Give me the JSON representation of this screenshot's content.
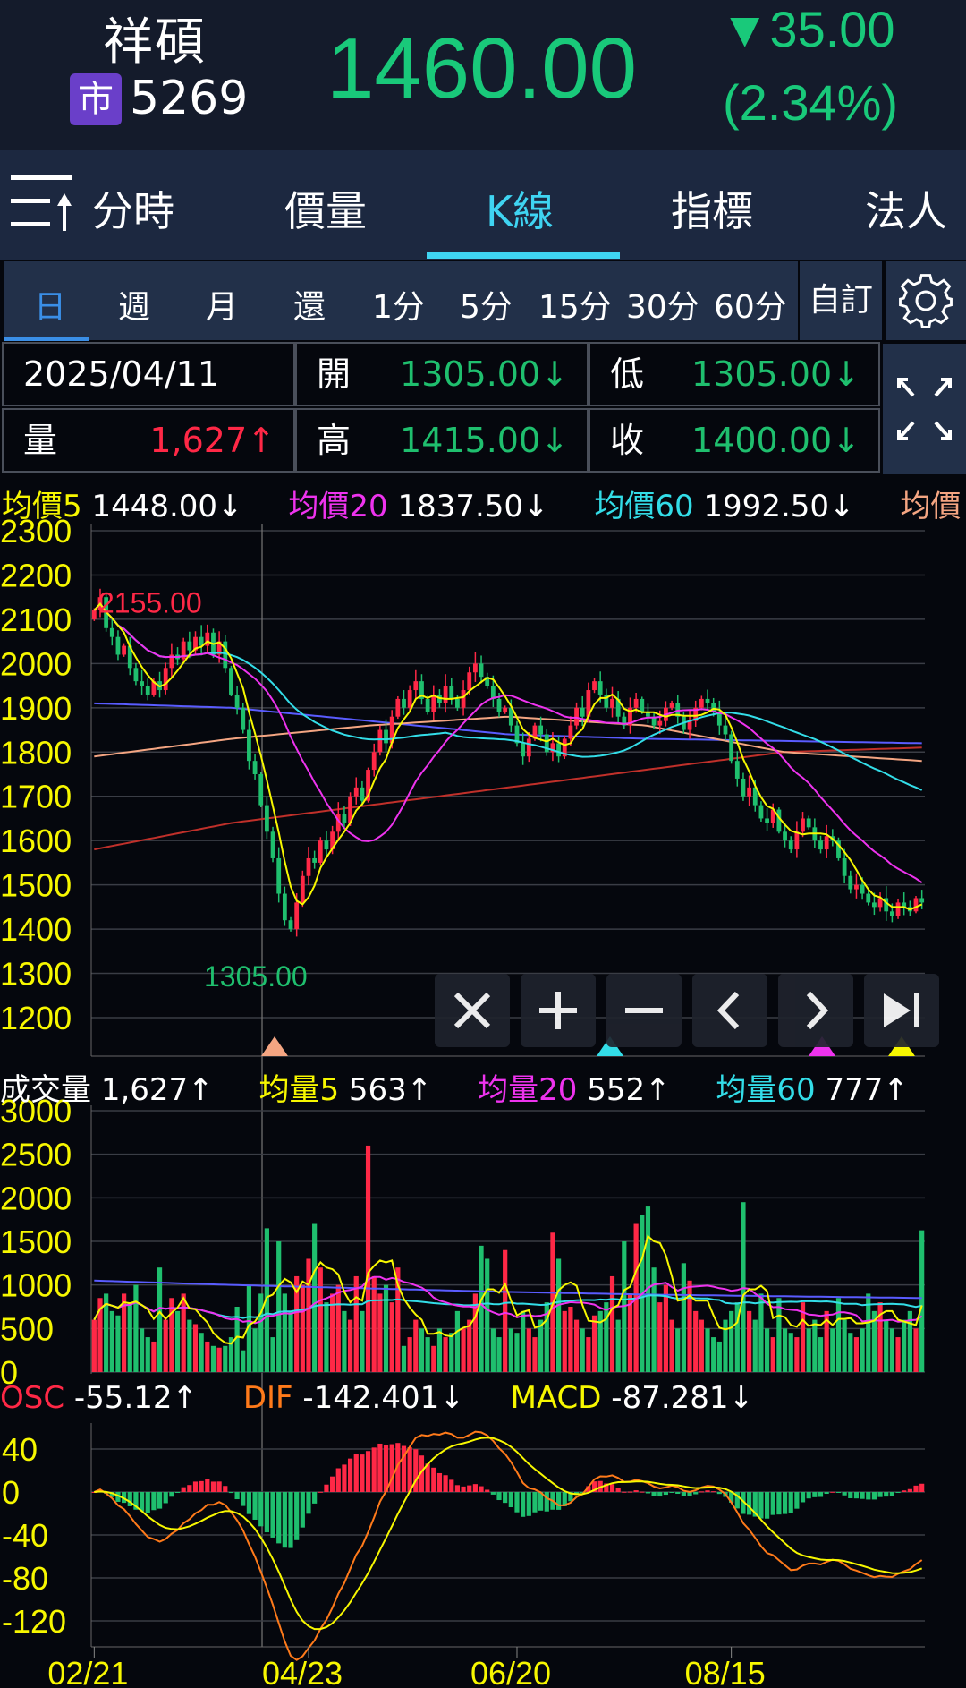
{
  "header": {
    "name": "祥碩",
    "market_badge": "市",
    "code": "5269",
    "price": "1460.00",
    "change": "▼35.00",
    "change_pct": "(2.34%)"
  },
  "tabs": [
    {
      "label": "分時"
    },
    {
      "label": "價量"
    },
    {
      "label": "K線",
      "active": true
    },
    {
      "label": "指標"
    },
    {
      "label": "法人"
    }
  ],
  "periods": [
    {
      "label": "日",
      "active": true
    },
    {
      "label": "週"
    },
    {
      "label": "月"
    },
    {
      "label": "還"
    },
    {
      "label": "1分"
    },
    {
      "label": "5分"
    },
    {
      "label": "15分"
    },
    {
      "label": "30分"
    },
    {
      "label": "60分"
    }
  ],
  "custom_label": "自訂",
  "info": {
    "date": "2025/04/11",
    "open_label": "開",
    "open": "1305.00↓",
    "low_label": "低",
    "low": "1305.00↓",
    "vol_label": "量",
    "vol": "1,627↑",
    "high_label": "高",
    "high": "1415.00↓",
    "close_label": "收",
    "close": "1400.00↓"
  },
  "ma_legend": [
    {
      "label": "均價5",
      "value": "1448.00↓",
      "color": "#f7f700"
    },
    {
      "label": "均價20",
      "value": "1837.50↓",
      "color": "#ee33ee"
    },
    {
      "label": "均價60",
      "value": "1992.50↓",
      "color": "#33dde8"
    },
    {
      "label": "均價",
      "value": "",
      "color": "#f4a582"
    }
  ],
  "vol_legend": [
    {
      "label": "成交量",
      "value": "1,627↑",
      "color": "#ffffff"
    },
    {
      "label": "均量5",
      "value": "563↑",
      "color": "#f7f700"
    },
    {
      "label": "均量20",
      "value": "552↑",
      "color": "#ee33ee"
    },
    {
      "label": "均量60",
      "value": "777↑",
      "color": "#33dde8"
    }
  ],
  "macd_legend": [
    {
      "label": "OSC",
      "value": "-55.12↑",
      "color": "#ff2846",
      "arrow": "#ff2846"
    },
    {
      "label": "DIF",
      "value": "-142.401↓",
      "color": "#ff7a1a",
      "arrow": "#1fbf6e"
    },
    {
      "label": "MACD",
      "value": "-87.281↓",
      "color": "#f7f700",
      "arrow": "#1fbf6e"
    }
  ],
  "controls": [
    "✕",
    "+",
    "−",
    "‹",
    "›",
    "⏭"
  ],
  "colors": {
    "up": "#ff2846",
    "down": "#1fbf6e",
    "ma5": "#f7f700",
    "ma20": "#ee33ee",
    "ma60": "#33dde8",
    "ma120": "#5a5cff",
    "ma240": "#f4a582",
    "ma_long": "#c0302a"
  },
  "chart_data": [
    {
      "type": "candlestick",
      "title": "K線",
      "ylim": [
        1150,
        2300
      ],
      "yticks": [
        2300,
        2200,
        2100,
        2000,
        1900,
        1800,
        1700,
        1600,
        1500,
        1400,
        1300,
        1200
      ],
      "max_label": "2155.00",
      "min_label": "1305.00",
      "max_index": 1,
      "min_index": 33,
      "xticks": [
        {
          "label": "02/21",
          "index": 0
        },
        {
          "label": "04/23",
          "index": 36
        },
        {
          "label": "06/20",
          "index": 71
        },
        {
          "label": "08/15",
          "index": 107
        }
      ],
      "close": [
        2120,
        2150,
        2080,
        2060,
        2020,
        2040,
        1990,
        1960,
        1950,
        1930,
        1960,
        1940,
        1990,
        2020,
        2010,
        2050,
        2030,
        2060,
        2040,
        2070,
        2020,
        2050,
        1990,
        1930,
        1900,
        1850,
        1780,
        1750,
        1680,
        1620,
        1560,
        1480,
        1420,
        1400,
        1460,
        1520,
        1560,
        1550,
        1600,
        1580,
        1620,
        1660,
        1640,
        1700,
        1720,
        1690,
        1760,
        1800,
        1850,
        1820,
        1880,
        1920,
        1900,
        1940,
        1960,
        1920,
        1890,
        1930,
        1910,
        1950,
        1920,
        1900,
        1940,
        1980,
        2000,
        1970,
        1950,
        1920,
        1890,
        1900,
        1860,
        1820,
        1790,
        1830,
        1860,
        1840,
        1800,
        1820,
        1790,
        1830,
        1860,
        1900,
        1880,
        1940,
        1960,
        1930,
        1900,
        1920,
        1880,
        1860,
        1900,
        1920,
        1890,
        1880,
        1860,
        1870,
        1900,
        1910,
        1880,
        1850,
        1870,
        1900,
        1920,
        1910,
        1890,
        1860,
        1840,
        1780,
        1740,
        1700,
        1720,
        1680,
        1650,
        1640,
        1670,
        1620,
        1600,
        1580,
        1620,
        1650,
        1630,
        1600,
        1580,
        1610,
        1600,
        1560,
        1520,
        1490,
        1500,
        1480,
        1460,
        1450,
        1470,
        1440,
        1430,
        1460,
        1450,
        1440,
        1470,
        1460
      ],
      "ma120_keypoints": [
        1910,
        1900,
        1870,
        1840,
        1830,
        1825,
        1820
      ],
      "ma240_keypoints": [
        1790,
        1830,
        1860,
        1880,
        1860,
        1800,
        1780
      ],
      "ma_long_keypoints": [
        1580,
        1640,
        1680,
        1720,
        1760,
        1800,
        1810
      ]
    },
    {
      "type": "bar",
      "title": "成交量",
      "ylim": [
        0,
        3000
      ],
      "yticks": [
        3000,
        2500,
        2000,
        1500,
        1000,
        500,
        0
      ],
      "values": [
        600,
        850,
        900,
        700,
        650,
        900,
        800,
        1000,
        500,
        400,
        350,
        1200,
        600,
        850,
        700,
        900,
        600,
        550,
        450,
        350,
        300,
        280,
        300,
        400,
        750,
        250,
        1000,
        500,
        900,
        1650,
        400,
        1500,
        900,
        700,
        1100,
        1000,
        1300,
        1700,
        1200,
        800,
        900,
        1000,
        700,
        600,
        1100,
        700,
        2600,
        1100,
        900,
        1000,
        800,
        1200,
        300,
        400,
        600,
        500,
        400,
        300,
        500,
        400,
        450,
        700,
        500,
        600,
        900,
        1450,
        1300,
        500,
        400,
        1400,
        500,
        450,
        700,
        500,
        400,
        600,
        800,
        1600,
        1300,
        700,
        750,
        600,
        500,
        400,
        650,
        700,
        800,
        1100,
        600,
        1500,
        900,
        1700,
        1800,
        1900,
        1200,
        800,
        1000,
        600,
        500,
        1250,
        1050,
        700,
        600,
        500,
        400,
        350,
        600,
        700,
        800,
        1950,
        700,
        600,
        900,
        500,
        400,
        850,
        500,
        450,
        400,
        800,
        500,
        600,
        400,
        700,
        500,
        850,
        600,
        450,
        400,
        500,
        900,
        700,
        800,
        600,
        500,
        400,
        600,
        700,
        500,
        1627
      ],
      "long_avg_keypoints": [
        1050,
        1000,
        960,
        920,
        890,
        870,
        850
      ]
    },
    {
      "type": "line",
      "title": "MACD",
      "ylim": [
        -150,
        75
      ],
      "yticks": [
        40,
        0,
        -40,
        -80,
        -120
      ],
      "series": [
        "DIF",
        "MACD",
        "OSC"
      ]
    }
  ]
}
